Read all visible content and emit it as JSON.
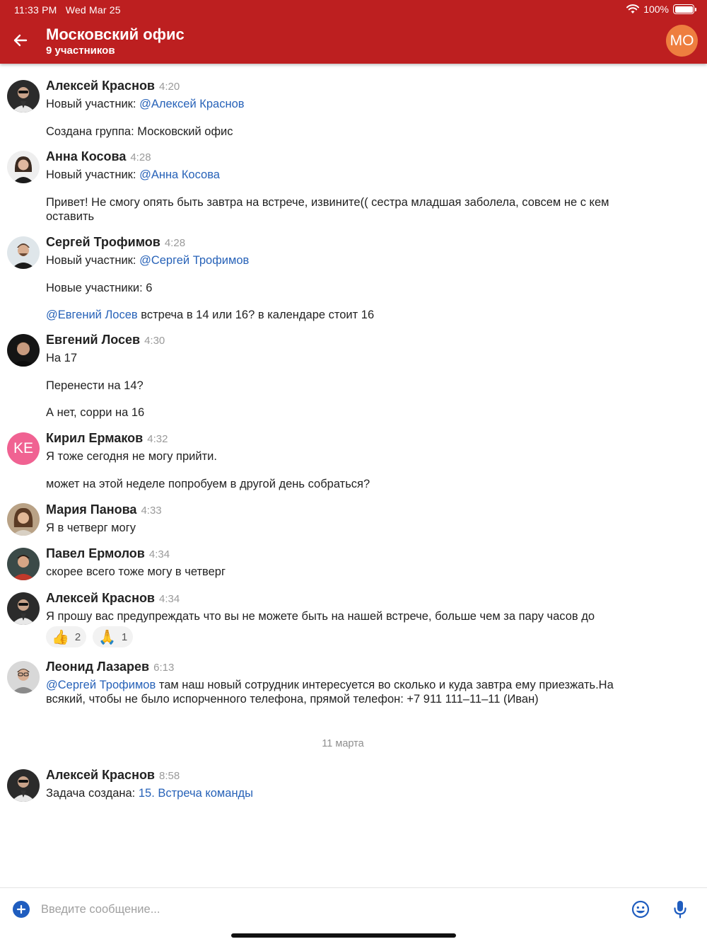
{
  "status_bar": {
    "time": "11:33 PM",
    "date": "Wed Mar 25",
    "battery": "100%"
  },
  "header": {
    "title": "Московский офис",
    "subtitle": "9 участников",
    "avatar_initials": "МО",
    "back_icon": "arrow-left-icon"
  },
  "colors": {
    "header_bg": "#bd1f20",
    "mention": "#2762b8",
    "header_avatar_bg": "#ee7e3f",
    "initials_avatar_bg": "#f06292",
    "accent": "#1f5dbf"
  },
  "messages": [
    {
      "sender": "Алексей Краснов",
      "time": "4:20",
      "lines": [
        {
          "prefix": "Новый участник: ",
          "mention": "@Алексей Краснов",
          "text": ""
        },
        {
          "prefix": "",
          "mention": "",
          "text": "Создана группа: Московский офис"
        }
      ]
    },
    {
      "sender": "Анна Косова",
      "time": "4:28",
      "lines": [
        {
          "prefix": "Новый участник: ",
          "mention": "@Анна Косова",
          "text": ""
        },
        {
          "prefix": "",
          "mention": "",
          "text": "Привет! Не смогу опять быть завтра на встрече, извините(( сестра младшая заболела, совсем не с кем оставить"
        }
      ]
    },
    {
      "sender": "Сергей Трофимов",
      "time": "4:28",
      "lines": [
        {
          "prefix": "Новый участник: ",
          "mention": "@Сергей Трофимов",
          "text": ""
        },
        {
          "prefix": "",
          "mention": "",
          "text": "Новые участники: 6"
        },
        {
          "prefix": "",
          "mention": "@Евгений Лосев",
          "text": " встреча в 14 или 16? в календаре стоит 16"
        }
      ]
    },
    {
      "sender": "Евгений Лосев",
      "time": "4:30",
      "lines": [
        {
          "prefix": "",
          "mention": "",
          "text": "На 17"
        },
        {
          "prefix": "",
          "mention": "",
          "text": "Перенести на 14?"
        },
        {
          "prefix": "",
          "mention": "",
          "text": "А нет, сорри на 16"
        }
      ]
    },
    {
      "sender": "Кирил Ермаков",
      "time": "4:32",
      "initials": "KE",
      "lines": [
        {
          "prefix": "",
          "mention": "",
          "text": "Я тоже сегодня не могу прийти."
        },
        {
          "prefix": "",
          "mention": "",
          "text": "может на этой неделе попробуем в другой день собраться?"
        }
      ]
    },
    {
      "sender": "Мария Панова",
      "time": "4:33",
      "lines": [
        {
          "prefix": "",
          "mention": "",
          "text": "Я в четверг могу"
        }
      ]
    },
    {
      "sender": "Павел Ермолов",
      "time": "4:34",
      "lines": [
        {
          "prefix": "",
          "mention": "",
          "text": "скорее всего тоже могу в четверг"
        }
      ]
    },
    {
      "sender": "Алексей Краснов",
      "time": "4:34",
      "lines": [
        {
          "prefix": "",
          "mention": "",
          "text": "Я прошу вас предупреждать что вы не можете быть на нашей встрече, больше чем за пару часов до"
        }
      ],
      "reactions": [
        {
          "emoji": "👍",
          "count": "2"
        },
        {
          "emoji": "🙏",
          "count": "1"
        }
      ]
    },
    {
      "sender": "Леонид Лазарев",
      "time": "6:13",
      "lines": [
        {
          "prefix": "",
          "mention": "@Сергей Трофимов",
          "text": " там наш новый сотрудник интересуется во сколько и куда завтра ему приезжать.На всякий, чтобы не было испорченного телефона, прямой телефон: +7 911 111–11–11 (Иван)"
        }
      ]
    }
  ],
  "date_divider": "11 марта",
  "last_message": {
    "sender": "Алексей Краснов",
    "time": "8:58",
    "prefix": "Задача создана: ",
    "link": "15. Встреча команды"
  },
  "composer": {
    "placeholder": "Введите сообщение...",
    "value": "",
    "add_icon": "plus-circle-icon",
    "emoji_icon": "smiley-icon",
    "mic_icon": "microphone-icon"
  }
}
